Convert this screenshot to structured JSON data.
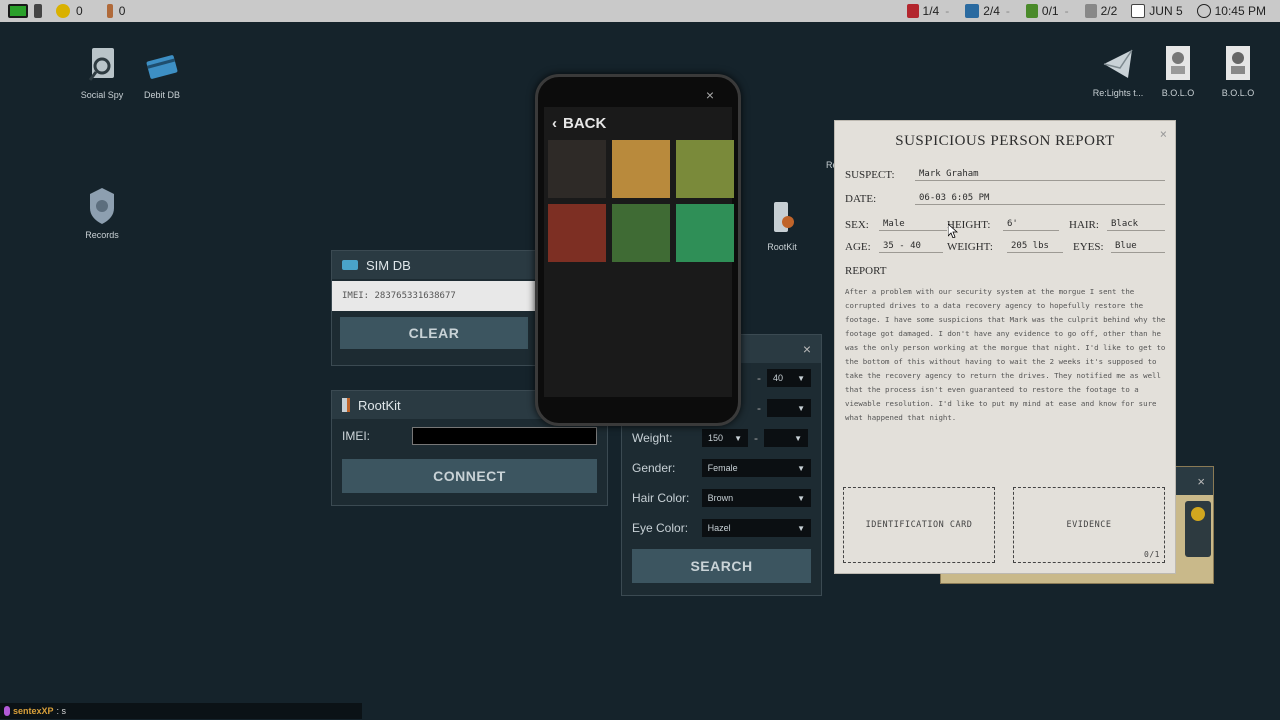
{
  "topbar": {
    "left": [
      {
        "icon": "monitor-icon",
        "value": ""
      },
      {
        "icon": "coin-icon",
        "value": "0"
      },
      {
        "icon": "torch-icon",
        "value": "0"
      }
    ],
    "right": [
      {
        "icon": "shield-badge-icon",
        "value": "1/4"
      },
      {
        "icon": "laptop-icon",
        "value": "2/4"
      },
      {
        "icon": "trash-can-icon",
        "value": "0/1"
      },
      {
        "icon": "notepad-icon",
        "value": "2/2"
      },
      {
        "icon": "calendar-icon",
        "value": "JUN 5"
      },
      {
        "icon": "clock-icon",
        "value": "10:45 PM"
      }
    ]
  },
  "desktop_icons": {
    "social_spy": "Social Spy",
    "debit_db": "Debit DB",
    "records": "Records",
    "rootkit": "RootKit",
    "mail": "Re:Lights t...",
    "bolo1": "B.O.L.O",
    "bolo2": "B.O.L.O",
    "partial": "Re"
  },
  "sim_db": {
    "title": "SIM DB",
    "imei_value": "IMEI: 283765331638677",
    "clear_label": "CLEAR"
  },
  "rootkit_win": {
    "title": "RootKit",
    "imei_label": "IMEI:",
    "imei_value": "",
    "connect_label": "CONNECT"
  },
  "search_form": {
    "close": "×",
    "age_max": "40",
    "weight_label": "Weight:",
    "weight_min": "150",
    "gender_label": "Gender:",
    "gender_value": "Female",
    "hair_label": "Hair Color:",
    "hair_value": "Brown",
    "eye_label": "Eye Color:",
    "eye_value": "Hazel",
    "search_label": "SEARCH"
  },
  "phone": {
    "close": "×",
    "back_label": "BACK",
    "thumb_colors": [
      "#2e2a27",
      "#b98a3c",
      "#7a8a3a",
      "#7d2f23",
      "#3f6b34",
      "#2f8f57"
    ]
  },
  "report": {
    "title": "SUSPICIOUS PERSON REPORT",
    "close": "×",
    "suspect_label": "SUSPECT:",
    "suspect_value": "Mark Graham",
    "date_label": "DATE:",
    "date_value": "06-03 6:05 PM",
    "sex_label": "SEX:",
    "sex_value": "Male",
    "height_label": "HEIGHT:",
    "height_value": "6'",
    "hair_label": "HAIR:",
    "hair_value": "Black",
    "age_label": "AGE:",
    "age_value": "35 - 40",
    "weight_label": "WEIGHT:",
    "weight_value": "205 lbs",
    "eyes_label": "EYES:",
    "eyes_value": "Blue",
    "report_label": "REPORT",
    "body": "After a problem with our security system at the morgue I sent the corrupted drives to a data recovery agency to hopefully restore the footage. I have some suspicions that Mark was the culprit behind why the footage got damaged. I don't have any evidence to go off, other than he was the only person working at the morgue that night. I'd like to get to the bottom of this without having to wait the 2 weeks it's supposed to take the recovery agency to return the drives. They notified me as well that the process isn't even guaranteed to restore the footage to a viewable resolution. I'd like to put my mind at ease and know for sure what happened that night.",
    "id_card_label": "IDENTIFICATION CARD",
    "evidence_label": "EVIDENCE",
    "evidence_count": "0/1"
  },
  "bg_window": {
    "close": "×"
  },
  "bottombar": {
    "user": "sentexXP",
    "prompt": ": s"
  }
}
